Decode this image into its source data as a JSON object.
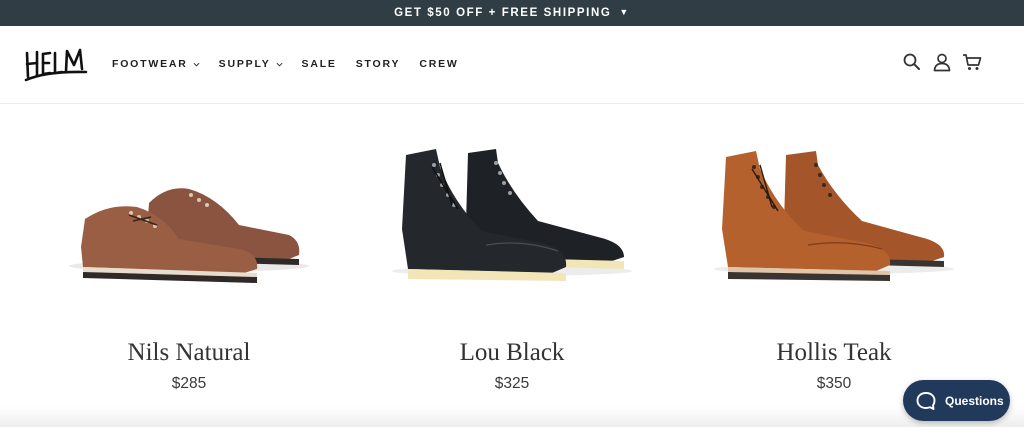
{
  "promo": {
    "text": "GET $50 OFF + FREE SHIPPING",
    "caret_icon": "caret-down-icon"
  },
  "brand": {
    "logo_text": "HELM"
  },
  "nav": {
    "items": [
      {
        "label": "FOOTWEAR",
        "has_dropdown": true
      },
      {
        "label": "SUPPLY",
        "has_dropdown": true
      },
      {
        "label": "SALE",
        "has_dropdown": false
      },
      {
        "label": "STORY",
        "has_dropdown": false
      },
      {
        "label": "CREW",
        "has_dropdown": false
      }
    ]
  },
  "header_icons": [
    "search-icon",
    "account-icon",
    "cart-icon"
  ],
  "products": [
    {
      "name": "Nils Natural",
      "price": "$285",
      "style": "oxford",
      "upper_color": "#9a5e45",
      "sole_color": "#2f2a27",
      "welt_color": "#e8ddcc"
    },
    {
      "name": "Lou Black",
      "price": "$325",
      "style": "boot",
      "upper_color": "#24272b",
      "sole_color": "#f2e6b8",
      "welt_color": "#e9dba6"
    },
    {
      "name": "Hollis Teak",
      "price": "$350",
      "style": "boot",
      "upper_color": "#b5612d",
      "sole_color": "#3a3430",
      "welt_color": "#e0c6a8"
    }
  ],
  "chat": {
    "label": "Questions",
    "icon": "chat-bubble-icon"
  },
  "colors": {
    "promo_bg": "#303d44",
    "chat_bg": "#213a5b"
  }
}
